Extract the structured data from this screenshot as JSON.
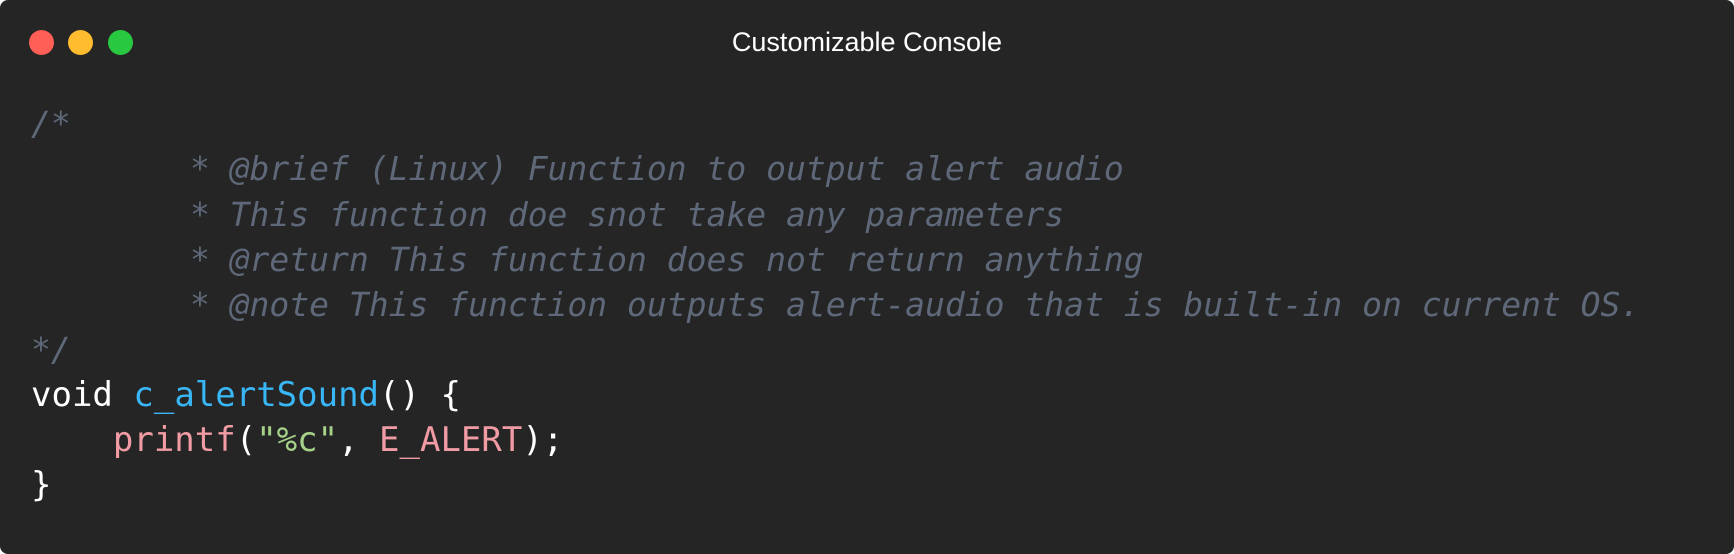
{
  "window": {
    "title": "Customizable Console",
    "controls": {
      "close_color": "#ff5f57",
      "minimize_color": "#febc2e",
      "maximize_color": "#28c840"
    },
    "background": "#252525"
  },
  "code": {
    "language": "c",
    "comment_lines": [
      "/*",
      "        * @brief (Linux) Function to output alert audio",
      "        * This function doe snot take any parameters",
      "        * @return This function does not return anything",
      "        * @note This function outputs alert-audio that is built-in on current OS.",
      "*/"
    ],
    "signature": {
      "return_type": "void",
      "space": " ",
      "name": "c_alertSound",
      "params": "()",
      "open_brace": " {"
    },
    "body": {
      "indent": "    ",
      "call": "printf",
      "open_paren": "(",
      "string": "\"%c\"",
      "comma": ", ",
      "argument": "E_ALERT",
      "close": ");"
    },
    "close_brace": "}"
  },
  "colors": {
    "comment": "#5e6879",
    "function_name": "#39b6f5",
    "call": "#f19ba4",
    "string": "#a6d189",
    "constant": "#f19ba4",
    "text": "#ffffff"
  }
}
